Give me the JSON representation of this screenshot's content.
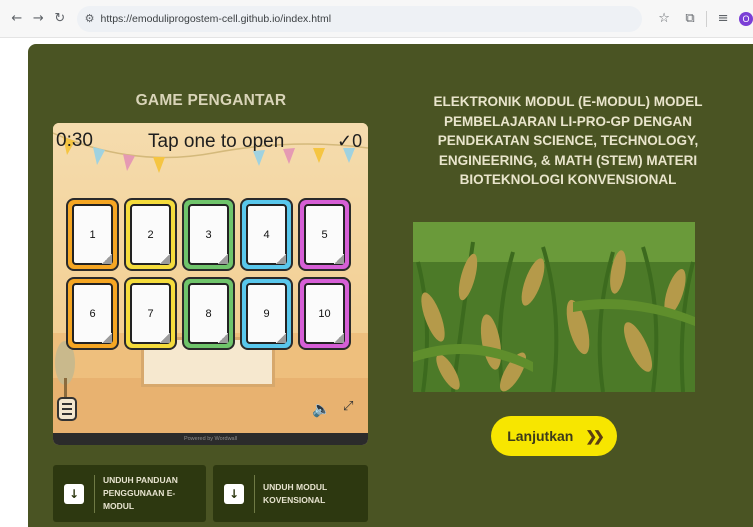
{
  "browser": {
    "url": "https://emoduliprogostem-cell.github.io/index.html",
    "icons": [
      "back-icon",
      "forward-icon",
      "reload-icon",
      "site-settings-icon",
      "bookmark-star-icon",
      "extensions-icon",
      "reading-list-icon",
      "profile-avatar"
    ],
    "profile_initial": "O"
  },
  "game": {
    "title": "GAME PENGANTAR",
    "timer": "0:30",
    "prompt": "Tap one to open",
    "score": "0",
    "cards": [
      "1",
      "2",
      "3",
      "4",
      "5",
      "6",
      "7",
      "8",
      "9",
      "10"
    ],
    "card_colors": [
      "#f5a623",
      "#f5dc3c",
      "#6fc46b",
      "#59c7ec",
      "#d65fd6"
    ],
    "footer": "Powered by Wordwall"
  },
  "downloads": {
    "guide_line1": "UNDUH PANDUAN",
    "guide_line2": "PENGGUNAAN E-MODUL",
    "module_line1": "UNDUH MODUL",
    "module_line2": "KOVENSIONAL"
  },
  "module": {
    "title": "ELEKTRONIK MODUL (E-MODUL) MODEL PEMBELAJARAN LI-PRO-GP DENGAN PENDEKATAN SCIENCE, TECHNOLOGY, ENGINEERING, & MATH (STEM) MATERI BIOTEKNOLOGI KONVENSIONAL",
    "next_label": "Lanjutkan",
    "next_arrow": "❯❯"
  },
  "colors": {
    "panel_bg": "#4a5423",
    "button_dark": "#2d3810",
    "accent_yellow": "#f7e600"
  }
}
